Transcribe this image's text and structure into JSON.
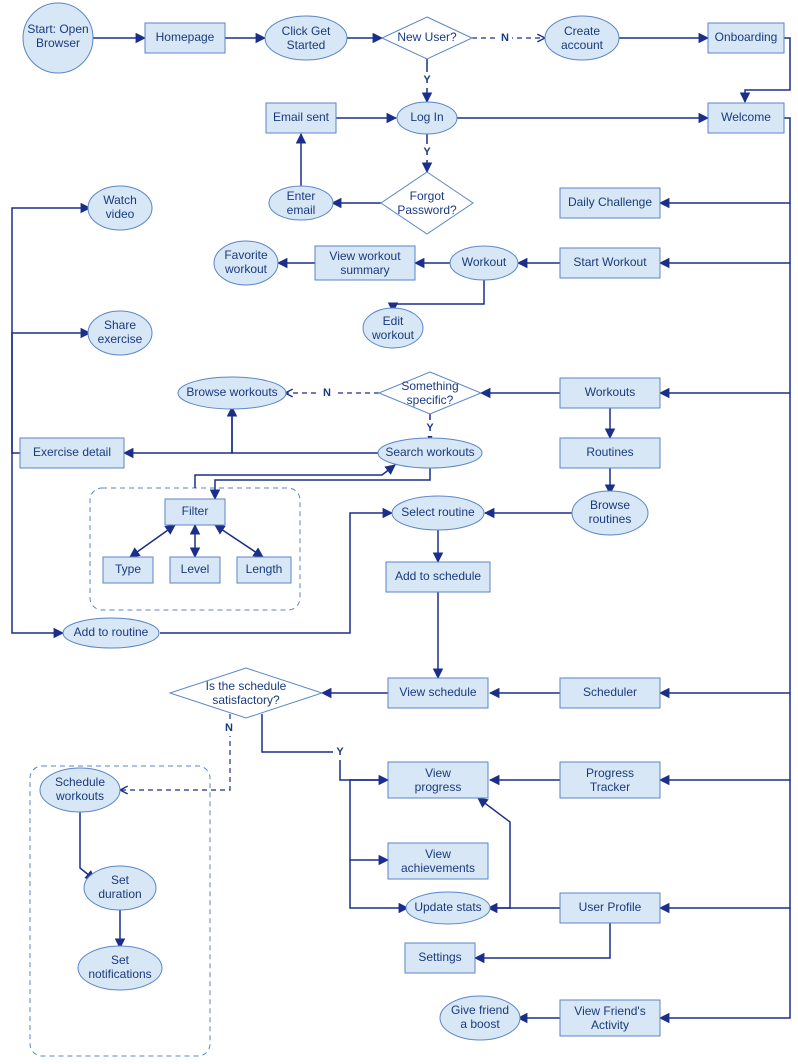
{
  "nodes": {
    "start": "Start: Open Browser",
    "homepage": "Homepage",
    "click_get_started": "Click Get Started",
    "new_user": "New User?",
    "create_account": "Create account",
    "onboarding": "Onboarding",
    "log_in": "Log In",
    "email_sent": "Email sent",
    "forgot_password_l1": "Forgot",
    "forgot_password_l2": "Password?",
    "enter_email": "Enter email",
    "welcome": "Welcome",
    "daily_challenge": "Daily Challenge",
    "start_workout": "Start Workout",
    "workout": "Workout",
    "view_workout_summary_l1": "View workout",
    "view_workout_summary_l2": "summary",
    "favorite_workout_l1": "Favorite",
    "favorite_workout_l2": "workout",
    "edit_workout_l1": "Edit",
    "edit_workout_l2": "workout",
    "watch_video_l1": "Watch",
    "watch_video_l2": "video",
    "share_exercise_l1": "Share",
    "share_exercise_l2": "exercise",
    "workouts": "Workouts",
    "something_specific_l1": "Something",
    "something_specific_l2": "specific?",
    "browse_workouts": "Browse workouts",
    "search_workouts": "Search workouts",
    "routines": "Routines",
    "browse_routines_l1": "Browse",
    "browse_routines_l2": "routines",
    "select_routine": "Select routine",
    "add_to_schedule": "Add to schedule",
    "filter": "Filter",
    "type": "Type",
    "level": "Level",
    "length": "Length",
    "exercise_detail": "Exercise detail",
    "add_to_routine": "Add to routine",
    "scheduler": "Scheduler",
    "view_schedule": "View schedule",
    "schedule_satisfactory_l1": "Is the schedule",
    "schedule_satisfactory_l2": "satisfactory?",
    "schedule_workouts_l1": "Schedule",
    "schedule_workouts_l2": "workouts",
    "set_duration_l1": "Set",
    "set_duration_l2": "duration",
    "set_notifications_l1": "Set",
    "set_notifications_l2": "notifications",
    "progress_tracker_l1": "Progress",
    "progress_tracker_l2": "Tracker",
    "view_progress_l1": "View",
    "view_progress_l2": "progress",
    "view_achievements_l1": "View",
    "view_achievements_l2": "achievements",
    "user_profile": "User Profile",
    "update_stats": "Update stats",
    "settings": "Settings",
    "view_friends_activity_l1": "View Friend's",
    "view_friends_activity_l2": "Activity",
    "give_friend_boost_l1": "Give friend",
    "give_friend_boost_l2": "a boost"
  },
  "labels": {
    "Y": "Y",
    "N": "N"
  }
}
